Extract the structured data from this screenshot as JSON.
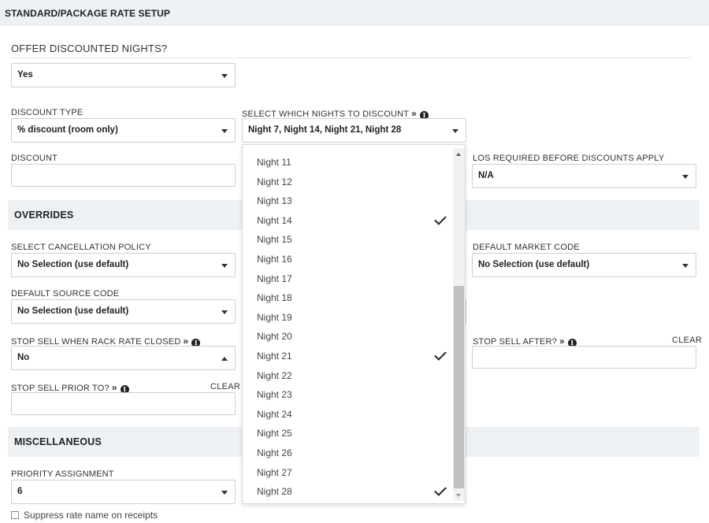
{
  "header": {
    "title": "STANDARD/PACKAGE RATE SETUP"
  },
  "offer": {
    "question": "OFFER DISCOUNTED NIGHTS?",
    "value": "Yes"
  },
  "discount_type": {
    "label": "DISCOUNT TYPE",
    "value": "% discount (room only)"
  },
  "select_nights": {
    "label": "SELECT WHICH NIGHTS TO DISCOUNT",
    "chevron": "»",
    "info": "i",
    "value": "Night 7, Night 14, Night 21, Night 28",
    "options": [
      {
        "label": "Night 11",
        "checked": false
      },
      {
        "label": "Night 12",
        "checked": false
      },
      {
        "label": "Night 13",
        "checked": false
      },
      {
        "label": "Night 14",
        "checked": true
      },
      {
        "label": "Night 15",
        "checked": false
      },
      {
        "label": "Night 16",
        "checked": false
      },
      {
        "label": "Night 17",
        "checked": false
      },
      {
        "label": "Night 18",
        "checked": false
      },
      {
        "label": "Night 19",
        "checked": false
      },
      {
        "label": "Night 20",
        "checked": false
      },
      {
        "label": "Night 21",
        "checked": true
      },
      {
        "label": "Night 22",
        "checked": false
      },
      {
        "label": "Night 23",
        "checked": false
      },
      {
        "label": "Night 24",
        "checked": false
      },
      {
        "label": "Night 25",
        "checked": false
      },
      {
        "label": "Night 26",
        "checked": false
      },
      {
        "label": "Night 27",
        "checked": false
      },
      {
        "label": "Night 28",
        "checked": true
      }
    ]
  },
  "discount": {
    "label": "DISCOUNT",
    "value": ""
  },
  "los": {
    "label": "LOS REQUIRED BEFORE DISCOUNTS APPLY",
    "value": "N/A"
  },
  "overrides": {
    "title": "OVERRIDES",
    "cancellation": {
      "label": "SELECT CANCELLATION POLICY",
      "value": "No Selection (use default)"
    },
    "market_code": {
      "label": "DEFAULT MARKET CODE",
      "value": "No Selection (use default)"
    },
    "source_code": {
      "label": "DEFAULT SOURCE CODE",
      "value": "No Selection (use default)"
    },
    "stop_sell_rack": {
      "label": "STOP SELL WHEN RACK RATE CLOSED",
      "chevron": "»",
      "info": "i",
      "value": "No"
    },
    "stop_sell_after": {
      "label": "STOP SELL AFTER?",
      "chevron": "»",
      "info": "i",
      "clear": "CLEAR",
      "value": ""
    },
    "stop_sell_prior": {
      "label": "STOP SELL PRIOR TO?",
      "chevron": "»",
      "info": "i",
      "clear": "CLEAR",
      "value": ""
    }
  },
  "misc": {
    "title": "MISCELLANEOUS",
    "priority": {
      "label": "PRIORITY ASSIGNMENT",
      "value": "6"
    },
    "suppress": {
      "label": "Suppress rate name on receipts",
      "checked": false
    }
  }
}
